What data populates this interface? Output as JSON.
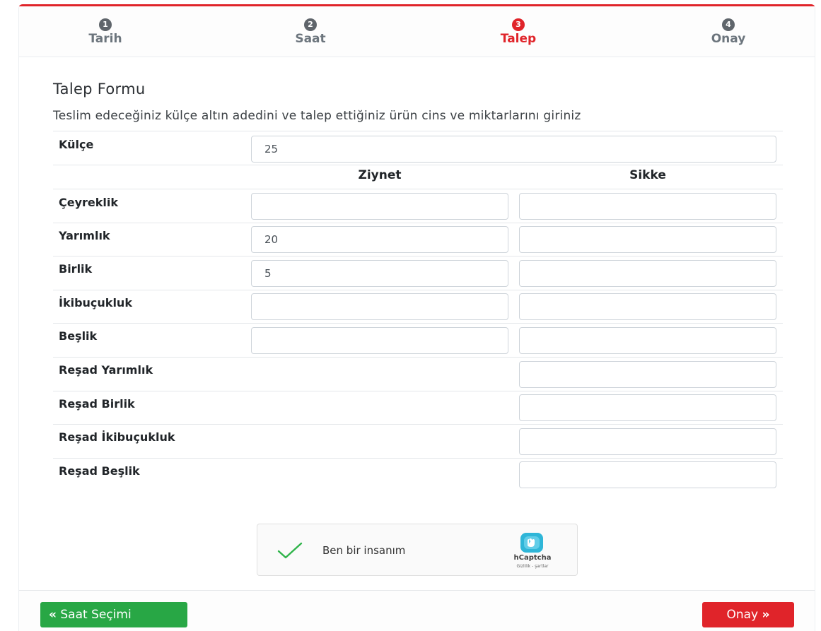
{
  "steps": [
    {
      "num": "1",
      "label": "Tarih"
    },
    {
      "num": "2",
      "label": "Saat"
    },
    {
      "num": "3",
      "label": "Talep"
    },
    {
      "num": "4",
      "label": "Onay"
    }
  ],
  "form": {
    "title": "Talep Formu",
    "description": "Teslim edeceğiniz külçe altın adedini ve talep ettiğiniz ürün cins ve miktarlarını giriniz",
    "kulce_label": "Külçe",
    "kulce_value": "25",
    "col_ziynet": "Ziynet",
    "col_sikke": "Sikke",
    "rows": [
      {
        "label": "Çeyreklik",
        "ziynet": "",
        "sikke": ""
      },
      {
        "label": "Yarımlık",
        "ziynet": "20",
        "sikke": ""
      },
      {
        "label": "Birlik",
        "ziynet": "5",
        "sikke": ""
      },
      {
        "label": "İkibuçukluk",
        "ziynet": "",
        "sikke": ""
      },
      {
        "label": "Beşlik",
        "ziynet": "",
        "sikke": ""
      },
      {
        "label": "Reşad Yarımlık",
        "sikke": ""
      },
      {
        "label": "Reşad Birlik",
        "sikke": ""
      },
      {
        "label": "Reşad İkibuçukluk",
        "sikke": ""
      },
      {
        "label": "Reşad Beşlik",
        "sikke": ""
      }
    ]
  },
  "captcha": {
    "text": "Ben bir insanım",
    "brand": "hCaptcha",
    "links": "Gizlilik - şartlar",
    "icon": "check-icon"
  },
  "buttons": {
    "back_label": "Saat Seçimi",
    "next_label": "Onay",
    "back_icon": "«",
    "next_icon": "»"
  },
  "colors": {
    "accent": "#e0242a",
    "success": "#28a745",
    "muted": "#5f656b"
  }
}
